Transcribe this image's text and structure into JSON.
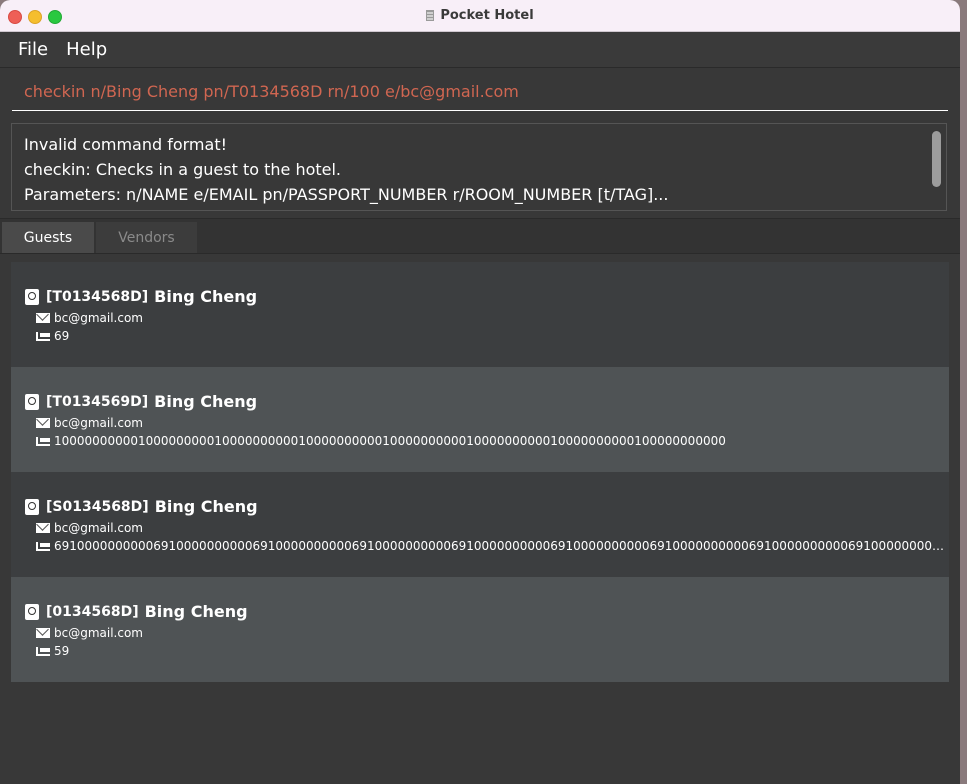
{
  "window": {
    "title": "Pocket Hotel"
  },
  "menu": [
    {
      "label": "File"
    },
    {
      "label": "Help"
    }
  ],
  "command": {
    "value": "checkin n/Bing Cheng pn/T0134568D rn/100 e/bc@gmail.com"
  },
  "result": {
    "lines": [
      "Invalid command format!",
      "checkin: Checks in a guest to the hotel.",
      "Parameters: n/NAME e/EMAIL pn/PASSPORT_NUMBER r/ROOM_NUMBER [t/TAG]..."
    ]
  },
  "tabs": [
    {
      "label": "Guests",
      "selected": true
    },
    {
      "label": "Vendors",
      "selected": false
    }
  ],
  "guests": [
    {
      "passport": "[T0134568D]",
      "name": "Bing Cheng",
      "email": "bc@gmail.com",
      "room": "69"
    },
    {
      "passport": "[T0134569D]",
      "name": "Bing Cheng",
      "email": "bc@gmail.com",
      "room": "1000000000010000000001000000000010000000000100000000001000000000010000000000100000000000"
    },
    {
      "passport": "[S0134568D]",
      "name": "Bing Cheng",
      "email": "bc@gmail.com",
      "room": "6910000000000691000000000069100000000006910000000000691000000000069100000000006910000000000691000000000069100000000006..."
    },
    {
      "passport": "[0134568D]",
      "name": "Bing Cheng",
      "email": "bc@gmail.com",
      "room": "59"
    }
  ],
  "colors": {
    "command_text": "#d06651",
    "card_dark": "#3c3e40",
    "card_light": "#4f5355",
    "background": "#383838"
  },
  "icons": {
    "passport": "passport-icon",
    "email": "mail-icon",
    "room": "bed-icon"
  }
}
